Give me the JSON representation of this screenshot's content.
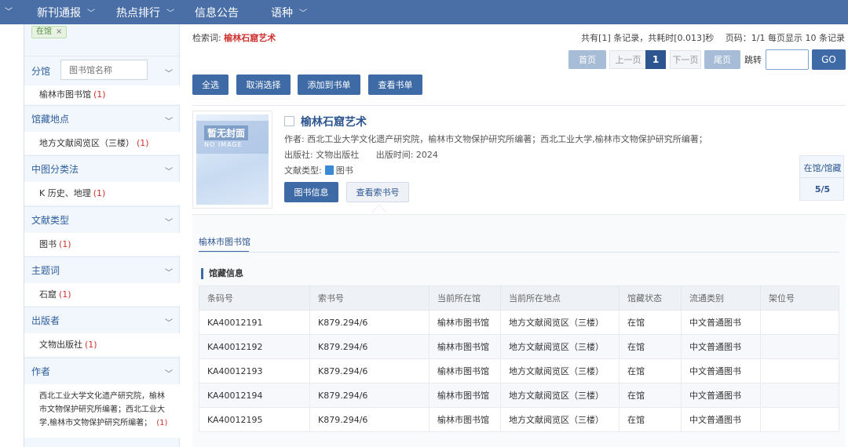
{
  "nav": {
    "items": [
      {
        "label": "新刊通报",
        "has_dropdown": true
      },
      {
        "label": "热点排行",
        "has_dropdown": true
      },
      {
        "label": "信息公告",
        "has_dropdown": false
      },
      {
        "label": "语种",
        "has_dropdown": true
      }
    ]
  },
  "sidebar": {
    "active_filter": "在馆",
    "branch": {
      "title": "分馆",
      "placeholder": "图书馆名称",
      "item": "榆林市图书馆",
      "count": "(1)"
    },
    "facets": [
      {
        "title": "馆藏地点",
        "item": "地方文献阅览区（三楼）",
        "count": "(1)"
      },
      {
        "title": "中图分类法",
        "item": "K 历史、地理",
        "count": "(1)"
      },
      {
        "title": "文献类型",
        "item": "图书",
        "count": "(1)"
      },
      {
        "title": "主题词",
        "item": "石窟",
        "count": "(1)"
      },
      {
        "title": "出版者",
        "item": "文物出版社",
        "count": "(1)"
      }
    ],
    "author": {
      "title": "作者",
      "lines": [
        "西北工业大学文化遗产研究院，榆林",
        "市文物保护研究所编著；西北工业大",
        "学,榆林市文物保护研究所编著；"
      ],
      "count": "(1)"
    }
  },
  "search": {
    "keyword_label": "检索词:",
    "keyword": "榆林石窟艺术",
    "total": "共有[1] 条记录，共耗时[0.013]秒　 页码：1/1 每页显示 10 条记录"
  },
  "pager": {
    "first": "首页",
    "prev": "上一页",
    "current": "1",
    "next": "下一页",
    "last": "尾页",
    "jump_label": "跳转",
    "go": "GO"
  },
  "actions": {
    "select_all": "全选",
    "cancel_select": "取消选择",
    "add_to_list": "添加到书单",
    "view_list": "查看书单"
  },
  "record": {
    "cover_title": "暂无封面",
    "cover_subtitle": "NO IMAGE",
    "title": "榆林石窟艺术",
    "author": "作者: 西北工业大学文化遗产研究院，榆林市文物保护研究所编著；西北工业大学,榆林市文物保护研究所编著；",
    "publisher": "出版社: 文物出版社",
    "pub_time": "出版时间: 2024",
    "doc_type_label": "文献类型:",
    "doc_type": "图书",
    "btn_info": "图书信息",
    "btn_callno": "查看索书号",
    "stock_label": "在馆/馆藏",
    "stock_value": "5/5"
  },
  "holdings": {
    "tab": "榆林市图书馆",
    "section": "馆藏信息",
    "columns": [
      "条码号",
      "索书号",
      "当前所在馆",
      "当前所在地点",
      "馆藏状态",
      "流通类别",
      "架位号"
    ],
    "rows": [
      [
        "KA40012191",
        "K879.294/6",
        "榆林市图书馆",
        "地方文献阅览区（三楼）",
        "在馆",
        "中文普通图书",
        ""
      ],
      [
        "KA40012192",
        "K879.294/6",
        "榆林市图书馆",
        "地方文献阅览区（三楼）",
        "在馆",
        "中文普通图书",
        ""
      ],
      [
        "KA40012193",
        "K879.294/6",
        "榆林市图书馆",
        "地方文献阅览区（三楼）",
        "在馆",
        "中文普通图书",
        ""
      ],
      [
        "KA40012194",
        "K879.294/6",
        "榆林市图书馆",
        "地方文献阅览区（三楼）",
        "在馆",
        "中文普通图书",
        ""
      ],
      [
        "KA40012195",
        "K879.294/6",
        "榆林市图书馆",
        "地方文献阅览区（三楼）",
        "在馆",
        "中文普通图书",
        ""
      ]
    ]
  },
  "colors": {
    "nav_bg": "#4a6fa7",
    "primary": "#3e6aa6",
    "accent_red": "#d0312d"
  }
}
